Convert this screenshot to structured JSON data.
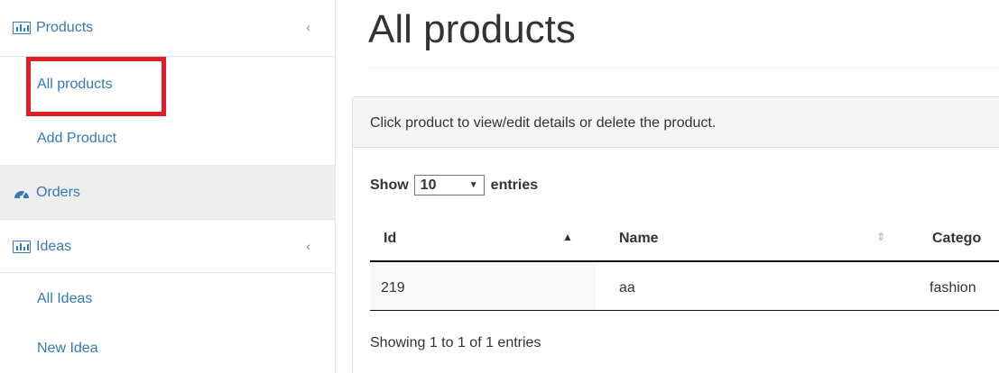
{
  "sidebar": {
    "products": {
      "label": "Products",
      "icon": "bar-chart-icon",
      "chevron": "‹"
    },
    "products_sub": [
      {
        "label": "All products"
      },
      {
        "label": "Add Product"
      }
    ],
    "orders": {
      "label": "Orders",
      "icon": "dashboard-icon"
    },
    "ideas": {
      "label": "Ideas",
      "icon": "bar-chart-icon",
      "chevron": "‹"
    },
    "ideas_sub": [
      {
        "label": "All Ideas"
      },
      {
        "label": "New Idea"
      }
    ]
  },
  "main": {
    "title": "All products",
    "panel_heading": "Click product to view/edit details or delete the product.",
    "length": {
      "prefix": "Show",
      "value": "10",
      "suffix": "entries"
    },
    "table": {
      "headers": [
        {
          "label": "Id",
          "sort": "▲"
        },
        {
          "label": "Name",
          "sort": "⇕"
        },
        {
          "label": "Catego"
        }
      ],
      "rows": [
        {
          "id": "219",
          "name": "aa",
          "category": "fashion"
        }
      ]
    },
    "info": "Showing 1 to 1 of 1 entries"
  },
  "colors": {
    "link": "#337ab7",
    "highlight": "#e01e27"
  }
}
